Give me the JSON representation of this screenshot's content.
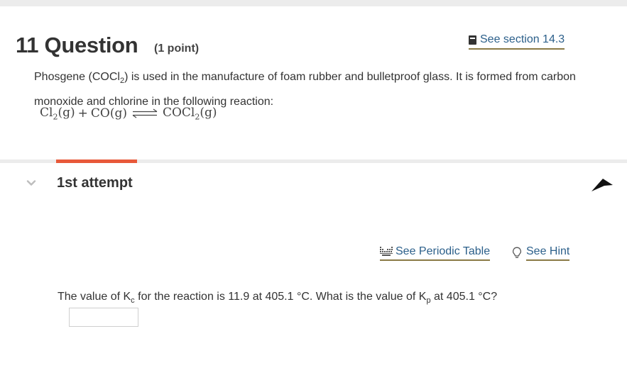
{
  "question": {
    "number": "11",
    "word": "Question",
    "points": "(1 point)",
    "see_section": "See section 14.3",
    "prompt_a": "Phosgene (COCl",
    "prompt_a_sub": "2",
    "prompt_b": ") is used in the manufacture of foam rubber and bulletproof glass. It is formed from carbon monoxide and chlorine in the following reaction:",
    "equation": {
      "r1": "Cl",
      "r1_sub": "2",
      "r1_state": "(g)",
      "plus": "+",
      "r2": "CO",
      "r2_state": "(g)",
      "p1": "COCl",
      "p1_sub": "2",
      "p1_state": "(g)"
    }
  },
  "attempt": {
    "title": "1st attempt",
    "periodic_table": "See Periodic Table",
    "hint": "See Hint",
    "q_part1": "The value of K",
    "q_sub1": "c",
    "q_part2": " for the reaction is 11.9 at 405.1 °C. What is the value of K",
    "q_sub2": "p",
    "q_part3": " at 405.1 °C?",
    "answer_value": ""
  },
  "colors": {
    "accent": "#e8593a",
    "link": "#2b5f8a",
    "link_underline": "#8a7a46"
  }
}
